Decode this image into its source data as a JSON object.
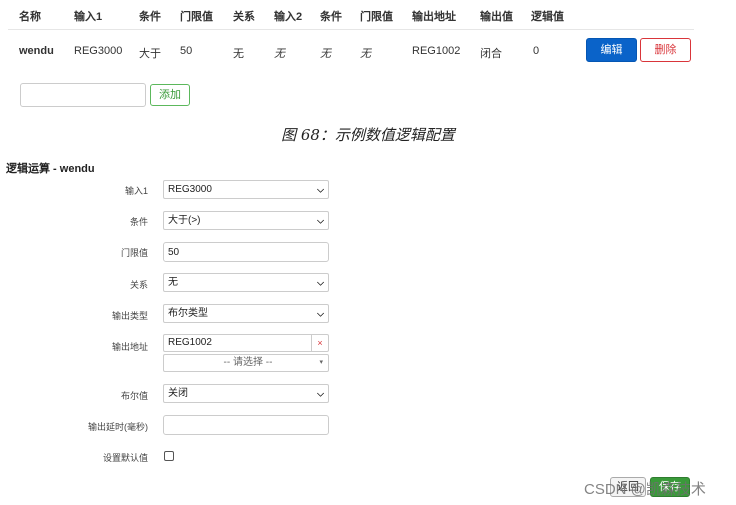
{
  "table": {
    "headers": [
      "名称",
      "输入1",
      "条件",
      "门限值",
      "关系",
      "输入2",
      "条件",
      "门限值",
      "输出地址",
      "输出值",
      "逻辑值"
    ],
    "row": {
      "name": "wendu",
      "input1": "REG3000",
      "cond1": "大于",
      "thr1": "50",
      "relation": "无",
      "input2": "无",
      "cond2": "无",
      "thr2": "无",
      "out_addr": "REG1002",
      "out_val": "闭合",
      "logic_val": "0"
    },
    "edit_label": "编辑",
    "delete_label": "删除"
  },
  "add": {
    "input_value": "",
    "button_label": "添加"
  },
  "caption": "图 68：示例数值逻辑配置",
  "form": {
    "title": "逻辑运算 - wendu",
    "fields": {
      "input1": {
        "label": "输入1",
        "value": "REG3000"
      },
      "condition": {
        "label": "条件",
        "value": "大于(>)"
      },
      "threshold": {
        "label": "门限值",
        "value": "50"
      },
      "relation": {
        "label": "关系",
        "value": "无"
      },
      "output_type": {
        "label": "输出类型",
        "value": "布尔类型"
      },
      "output_addr": {
        "label": "输出地址",
        "value": "REG1002",
        "select_placeholder": "-- 请选择 --"
      },
      "bool_val": {
        "label": "布尔值",
        "value": "关闭"
      },
      "delay": {
        "label": "输出延时(毫秒)",
        "value": ""
      },
      "default": {
        "label": "设置默认值"
      }
    }
  },
  "footer": {
    "back_label": "返回",
    "save_label": "保存",
    "watermark": "CSDN @凯森技术"
  },
  "colors": {
    "primary": "#0a63c9",
    "danger": "#d9353a",
    "success": "#5cb85c"
  }
}
